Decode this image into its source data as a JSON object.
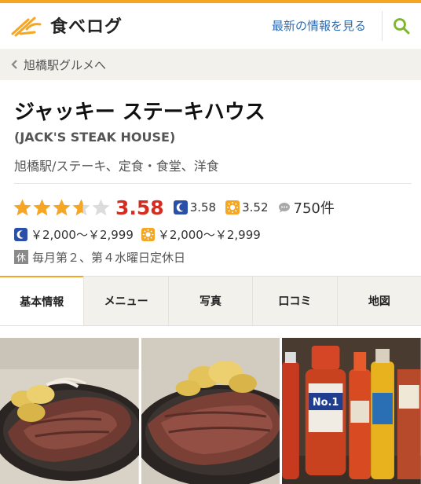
{
  "header": {
    "logo_text": "食べログ",
    "latest_link": "最新の情報を見る",
    "search_icon": "search-icon",
    "accent_color": "#f5a623"
  },
  "breadcrumb": {
    "label": "旭橋駅グルメへ",
    "icon": "chevron-left-icon"
  },
  "restaurant": {
    "name": "ジャッキー ステーキハウス",
    "name_en": "(JACK'S STEAK HOUSE)",
    "genre": "旭橋駅/ステーキ、定食・食堂、洋食",
    "rating": "3.58",
    "rating_value": 3.58,
    "rating_max": 5,
    "dinner_rating": "3.58",
    "lunch_rating": "3.52",
    "review_count": "750件",
    "dinner_price": "￥2,000～￥2,999",
    "lunch_price": "￥2,000～￥2,999",
    "holiday_badge": "休",
    "holiday_text": "毎月第２、第４水曜日定休日",
    "rating_color": "#d62b1f",
    "star_color": "#f5a623"
  },
  "tabs": [
    {
      "label": "基本情報",
      "active": true
    },
    {
      "label": "メニュー",
      "active": false
    },
    {
      "label": "写真",
      "active": false
    },
    {
      "label": "口コミ",
      "active": false
    },
    {
      "label": "地図",
      "active": false
    }
  ],
  "photos": [
    {
      "subject": "steak-on-sizzling-plate"
    },
    {
      "subject": "steak-closeup"
    },
    {
      "subject": "sauce-bottles"
    }
  ]
}
